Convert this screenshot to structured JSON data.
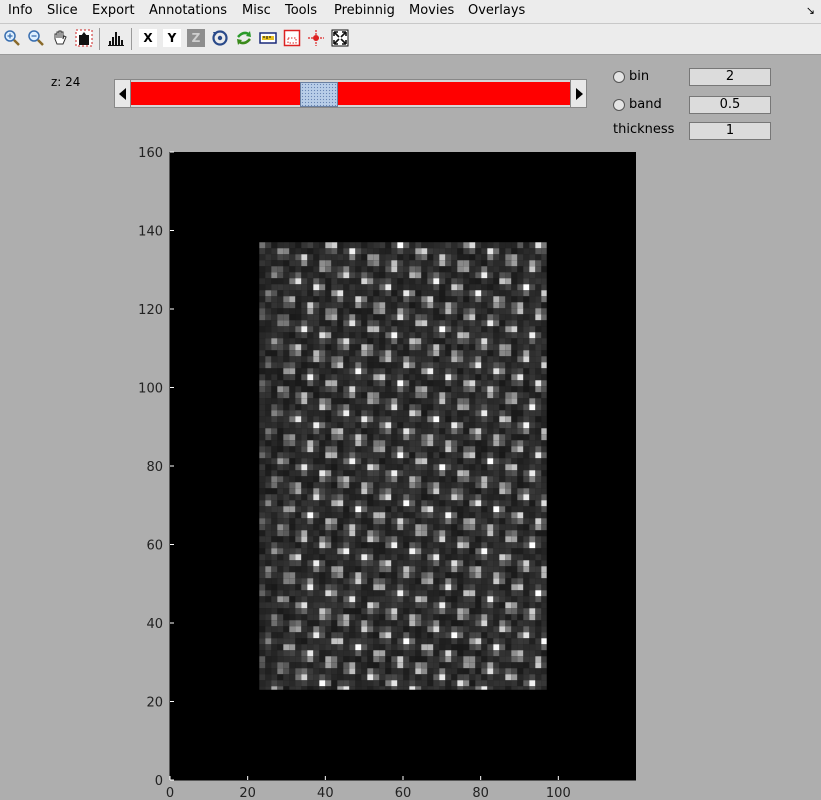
{
  "menu": [
    "Info",
    "Slice",
    "Export",
    "Annotations",
    "Misc",
    "Tools",
    "Prebinnig",
    "Movies",
    "Overlays"
  ],
  "menu_corner_icon": "arrow-icon",
  "toolbar": {
    "icons": [
      "zoom-in-icon",
      "zoom-out-icon",
      "pan-hand-icon",
      "brightness-icon",
      "histogram-icon",
      "x-icon",
      "y-icon",
      "z-icon",
      "rotate-icon",
      "swap-icon",
      "ruler-icon",
      "roi-box-icon",
      "crosshair-icon",
      "fit-view-icon"
    ],
    "x_label": "X",
    "y_label": "Y",
    "z_label": "Z"
  },
  "slice": {
    "label": "z: 24",
    "position": 0.42
  },
  "options": {
    "bin_label": "bin",
    "bin_value": "2",
    "band_label": "band",
    "band_value": "0.5",
    "thickness_label": "thickness",
    "thickness_value": "1"
  },
  "plot": {
    "y_ticks": [
      "0",
      "20",
      "40",
      "60",
      "80",
      "100",
      "120",
      "140",
      "160"
    ],
    "x_ticks": [
      "0",
      "20",
      "40",
      "60",
      "80",
      "100"
    ],
    "xlim": [
      0,
      120
    ],
    "ylim": [
      0,
      160
    ],
    "image_extent": {
      "x": [
        23,
        97
      ],
      "y": [
        23,
        137
      ]
    }
  }
}
